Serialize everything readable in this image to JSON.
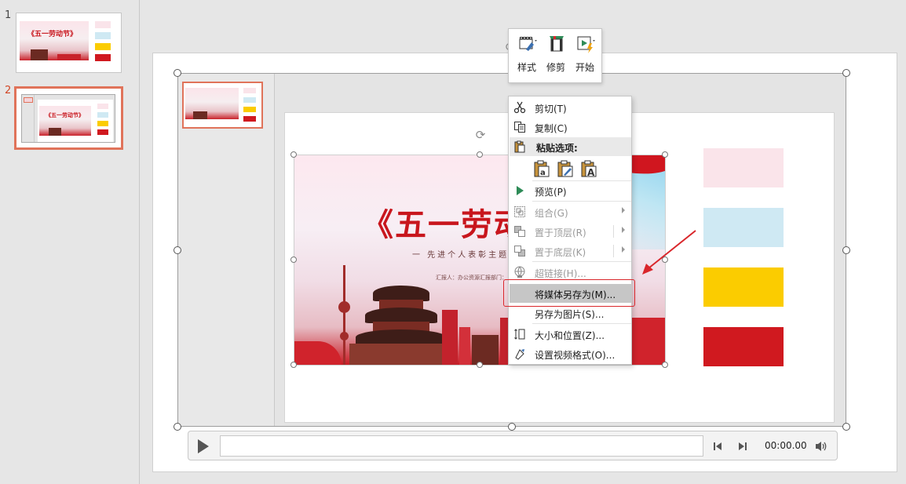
{
  "thumbnails": [
    {
      "number": "1",
      "title": "《五一劳动节》"
    },
    {
      "number": "2",
      "title": "《五一劳动节》"
    }
  ],
  "poster": {
    "title": "《五一劳动节",
    "subtitle": "一  先进个人表彰主题",
    "meta_reporter": "汇报人：办公资源",
    "meta_dept": "汇报部门：",
    "colors": {
      "red": "#c8161d",
      "pink": "#fde8ef"
    }
  },
  "swatches": [
    {
      "name": "pink",
      "color": "#fae4ea"
    },
    {
      "name": "light-blue",
      "color": "#cfe9f3"
    },
    {
      "name": "yellow",
      "color": "#fbcc00"
    },
    {
      "name": "red",
      "color": "#d0191f"
    }
  ],
  "media_bar": {
    "time": "00:00.00"
  },
  "mini_toolbar": {
    "style_label": "样式",
    "trim_label": "修剪",
    "start_label": "开始"
  },
  "context_menu": {
    "cut": "剪切(T)",
    "copy": "复制(C)",
    "paste_options": "粘贴选项:",
    "preview": "预览(P)",
    "group": "组合(G)",
    "bring_to_front": "置于顶层(R)",
    "send_to_back": "置于底层(K)",
    "hyperlink": "超链接(H)...",
    "save_media_as": "将媒体另存为(M)...",
    "save_as_picture": "另存为图片(S)...",
    "size_and_position": "大小和位置(Z)...",
    "format_video": "设置视频格式(O)..."
  },
  "accent_colors": {
    "highlight": "#d9262b",
    "selected_thumb": "#e0735a"
  }
}
